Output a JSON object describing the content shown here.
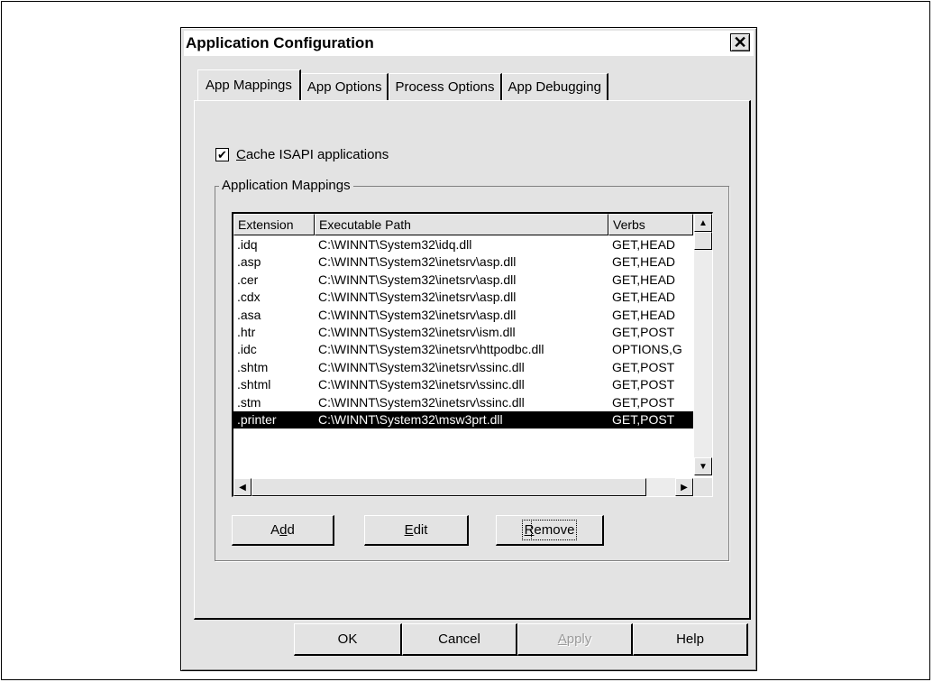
{
  "window": {
    "title": "Application Configuration",
    "close_glyph": "✕"
  },
  "tabs": [
    {
      "label": "App Mappings",
      "active": true
    },
    {
      "label": "App Options",
      "active": false
    },
    {
      "label": "Process Options",
      "active": false
    },
    {
      "label": "App Debugging",
      "active": false
    }
  ],
  "cache_checkbox": {
    "checked": true,
    "mnemonic": "C",
    "rest": "ache ISAPI applications"
  },
  "group": {
    "label": "Application Mappings"
  },
  "list": {
    "columns": [
      "Extension",
      "Executable Path",
      "Verbs"
    ],
    "rows": [
      {
        "ext": ".idq",
        "path": "C:\\WINNT\\System32\\idq.dll",
        "verbs": "GET,HEAD"
      },
      {
        "ext": ".asp",
        "path": "C:\\WINNT\\System32\\inetsrv\\asp.dll",
        "verbs": "GET,HEAD"
      },
      {
        "ext": ".cer",
        "path": "C:\\WINNT\\System32\\inetsrv\\asp.dll",
        "verbs": "GET,HEAD"
      },
      {
        "ext": ".cdx",
        "path": "C:\\WINNT\\System32\\inetsrv\\asp.dll",
        "verbs": "GET,HEAD"
      },
      {
        "ext": ".asa",
        "path": "C:\\WINNT\\System32\\inetsrv\\asp.dll",
        "verbs": "GET,HEAD"
      },
      {
        "ext": ".htr",
        "path": "C:\\WINNT\\System32\\inetsrv\\ism.dll",
        "verbs": "GET,POST"
      },
      {
        "ext": ".idc",
        "path": "C:\\WINNT\\System32\\inetsrv\\httpodbc.dll",
        "verbs": "OPTIONS,G"
      },
      {
        "ext": ".shtm",
        "path": "C:\\WINNT\\System32\\inetsrv\\ssinc.dll",
        "verbs": "GET,POST"
      },
      {
        "ext": ".shtml",
        "path": "C:\\WINNT\\System32\\inetsrv\\ssinc.dll",
        "verbs": "GET,POST"
      },
      {
        "ext": ".stm",
        "path": "C:\\WINNT\\System32\\inetsrv\\ssinc.dll",
        "verbs": "GET,POST"
      },
      {
        "ext": ".printer",
        "path": "C:\\WINNT\\System32\\msw3prt.dll",
        "verbs": "GET,POST"
      }
    ],
    "selected_index": 10
  },
  "mapping_buttons": {
    "add": {
      "pre": "A",
      "mnemonic": "d",
      "post": "d"
    },
    "edit": {
      "pre": "",
      "mnemonic": "E",
      "post": "dit"
    },
    "remove": {
      "pre": "",
      "mnemonic": "R",
      "post": "emove"
    }
  },
  "dialog_buttons": {
    "ok": "OK",
    "cancel": "Cancel",
    "apply": {
      "mnemonic": "A",
      "post": "pply"
    },
    "help": "Help"
  },
  "icons": {
    "scroll_up": "▲",
    "scroll_down": "▼",
    "scroll_left": "◀",
    "scroll_right": "▶",
    "check": "✔"
  }
}
